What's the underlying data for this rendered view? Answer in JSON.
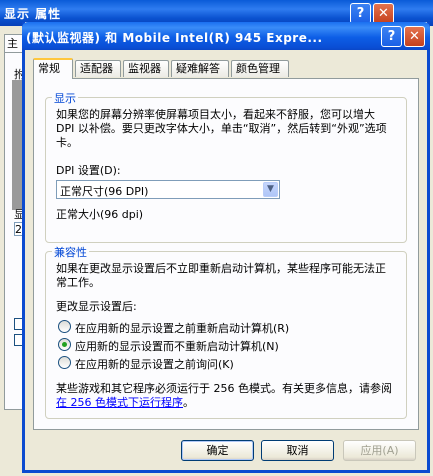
{
  "background_window": {
    "title": "显示 属性",
    "tab_label": "主",
    "fragment_1": "拊",
    "fragment_2": "显",
    "fragment_3": "2",
    "help_label": "?",
    "close_label": "✕"
  },
  "dialog": {
    "title": "(默认监视器) 和 Mobile Intel(R) 945 Expre...",
    "help_label": "?",
    "close_label": "✕"
  },
  "tabs": [
    {
      "label": "常规",
      "active": true
    },
    {
      "label": "适配器",
      "active": false
    },
    {
      "label": "监视器",
      "active": false
    },
    {
      "label": "疑难解答",
      "active": false
    },
    {
      "label": "颜色管理",
      "active": false
    }
  ],
  "display_group": {
    "legend": "显示",
    "description": "如果您的屏幕分辨率使屏幕项目太小，看起来不舒服，您可以增大 DPI 以补偿。要只更改字体大小，单击“取消”，然后转到“外观”选项卡。",
    "dpi_label": "DPI 设置(D):",
    "dpi_value": "正常尺寸(96 DPI)",
    "dpi_caption": "正常大小(96 dpi)"
  },
  "compat_group": {
    "legend": "兼容性",
    "description": "如果在更改显示设置后不立即重新启动计算机，某些程序可能无法正常工作。",
    "after_change_label": "更改显示设置后:",
    "options": [
      {
        "label": "在应用新的显示设置之前重新启动计算机(R)",
        "checked": false
      },
      {
        "label": "应用新的显示设置而不重新启动计算机(N)",
        "checked": true
      },
      {
        "label": "在应用新的显示设置之前询问(K)",
        "checked": false
      }
    ],
    "note_text": "某些游戏和其它程序必须运行于 256 色模式。有关更多信息，请参阅",
    "note_link": "在 256 色模式下运行程序",
    "note_end": "。"
  },
  "buttons": {
    "ok": "确定",
    "cancel": "取消",
    "apply": "应用(A)"
  },
  "colors": {
    "titlebar": "#0a5bd8",
    "legend_text": "#0046d5",
    "active_tab_accent": "#ffc73c",
    "link": "#0000ff",
    "radio_dot": "#21a121"
  }
}
